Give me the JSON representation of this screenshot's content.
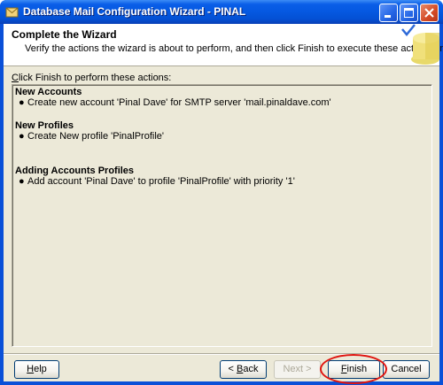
{
  "window": {
    "title": "Database Mail Configuration Wizard - PINAL",
    "buttons": {
      "minimize": "_",
      "maximize": "□",
      "close": "✕"
    }
  },
  "header": {
    "title": "Complete the Wizard",
    "subtitle": "Verify the actions the wizard is about to perform, and then click Finish to execute these actions on the server."
  },
  "instruction": {
    "accel": "C",
    "rest": "lick Finish to perform these actions:"
  },
  "report": {
    "sections": [
      {
        "title": "New Accounts",
        "items": [
          "Create new account 'Pinal Dave' for SMTP server 'mail.pinaldave.com'"
        ]
      },
      {
        "title": "New Profiles",
        "items": [
          "Create New profile 'PinalProfile'"
        ]
      },
      {
        "title": "Adding Accounts Profiles",
        "items": [
          "Add account 'Pinal Dave' to profile 'PinalProfile' with priority '1'"
        ]
      }
    ],
    "bullet": "●"
  },
  "buttons": {
    "help": {
      "accel": "H",
      "rest": "elp"
    },
    "back": {
      "prefix": "< ",
      "accel": "B",
      "rest": "ack"
    },
    "next": {
      "label": "Next >"
    },
    "finish": {
      "accel": "F",
      "rest": "inish"
    },
    "cancel": {
      "label": "Cancel"
    }
  },
  "colors": {
    "titlebar": "#0558e0",
    "face": "#ece9d8",
    "annotation": "#e0140f"
  }
}
